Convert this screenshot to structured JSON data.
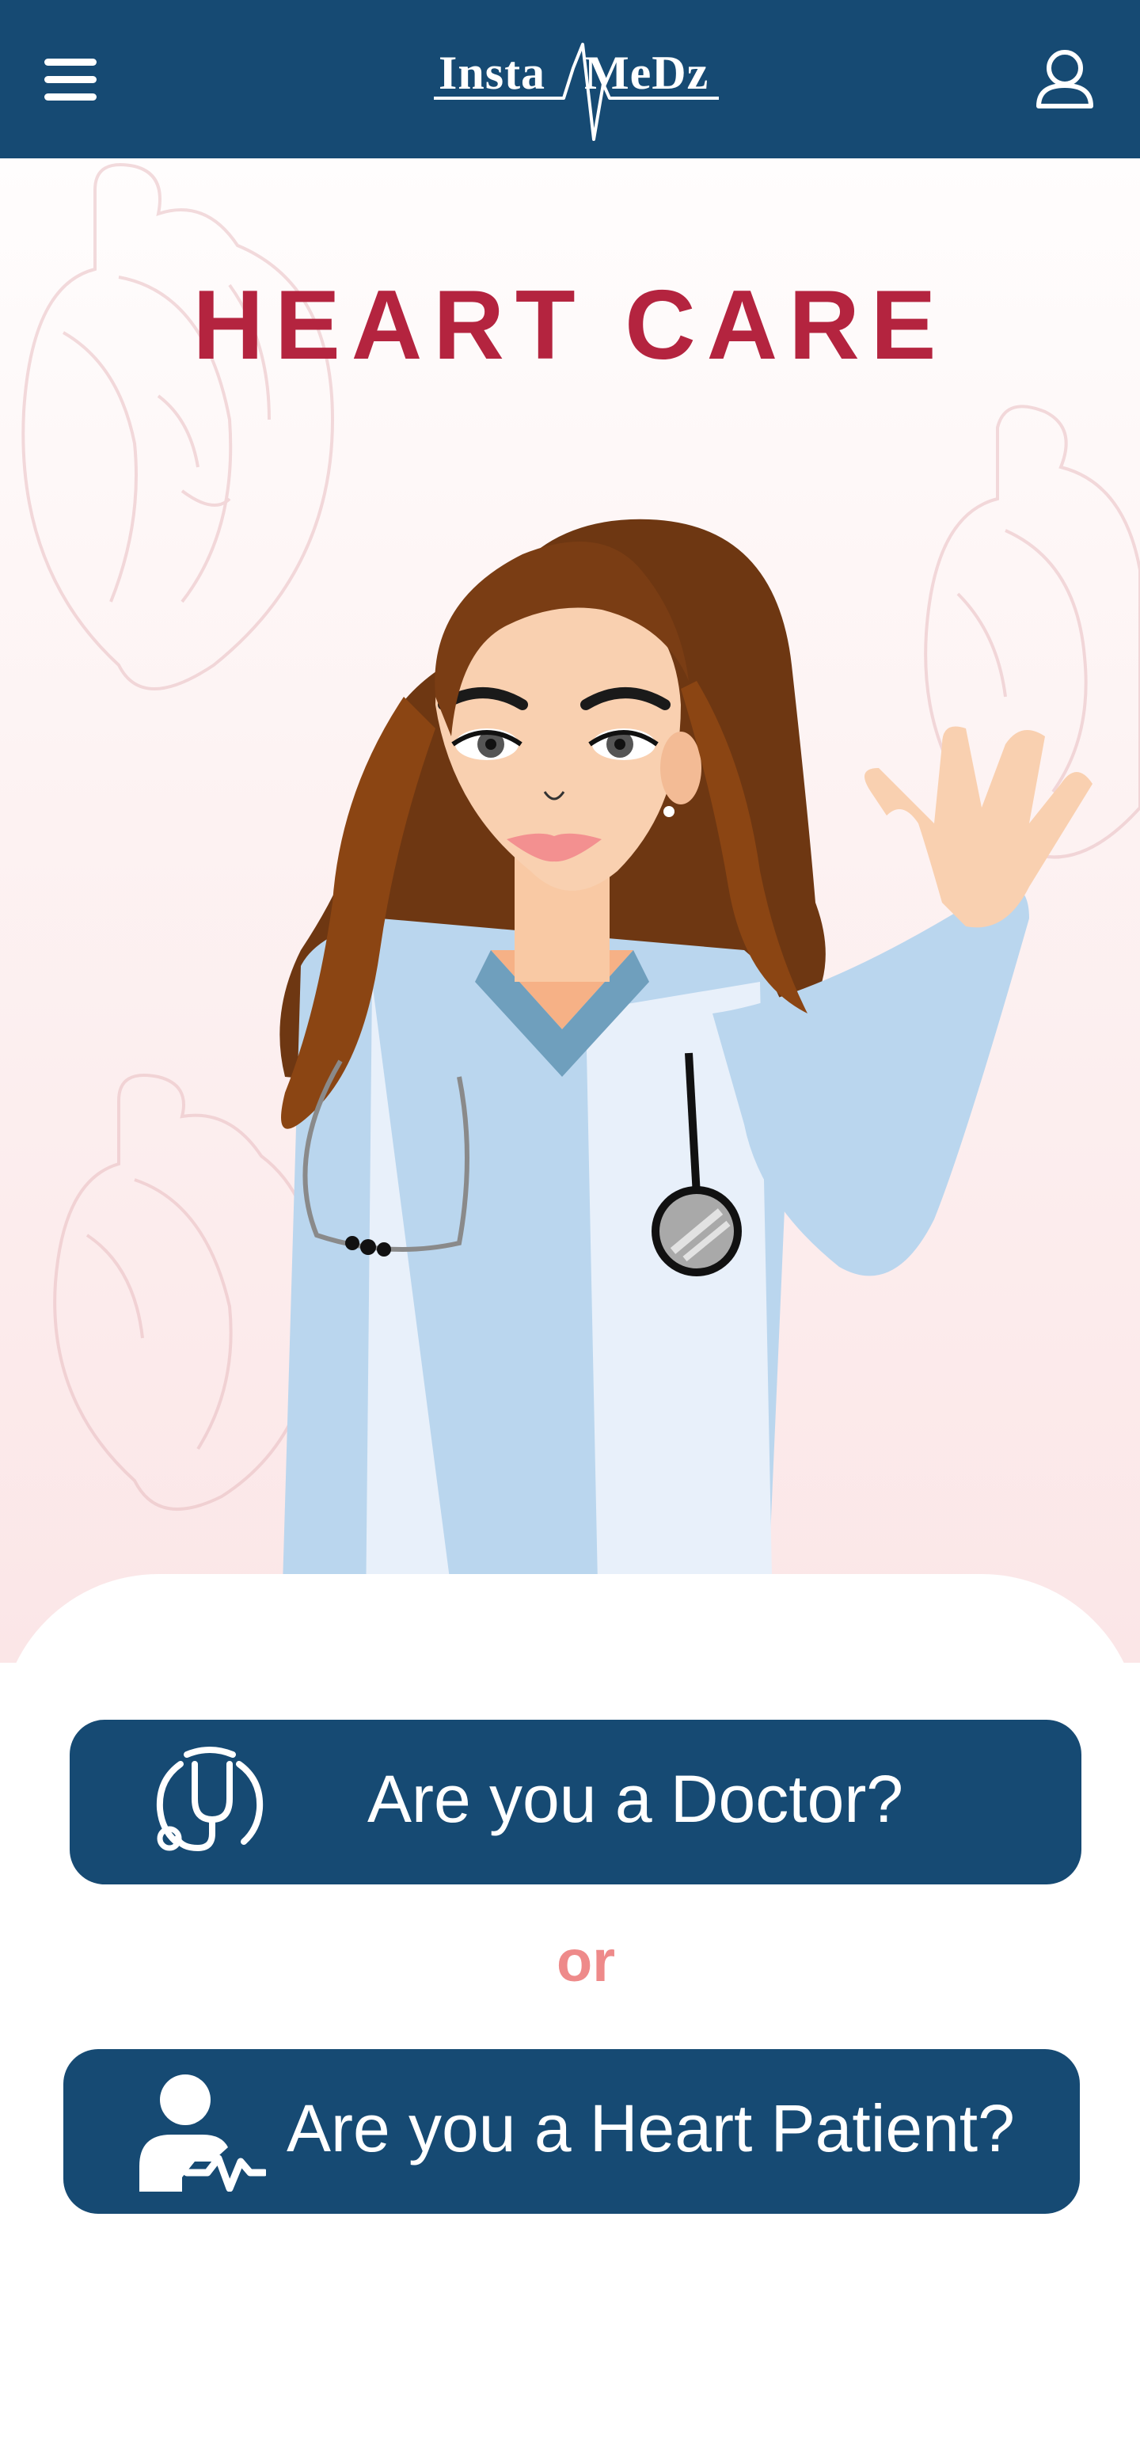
{
  "header": {
    "logo_left": "Insta",
    "logo_right": "MeDz",
    "menu_icon": "hamburger-menu-icon",
    "user_icon": "user-profile-icon"
  },
  "hero": {
    "title": "HEART CARE",
    "illustration": "waving-female-doctor-illustration"
  },
  "actions": {
    "doctor_label": "Are you a Doctor?",
    "doctor_icon": "stethoscope-icon",
    "or_label": "or",
    "patient_label": "Are you a Heart Patient?",
    "patient_icon": "patient-heartbeat-icon"
  },
  "colors": {
    "primary": "#164a73",
    "title": "#b4243f",
    "or": "#ee8a8a"
  }
}
